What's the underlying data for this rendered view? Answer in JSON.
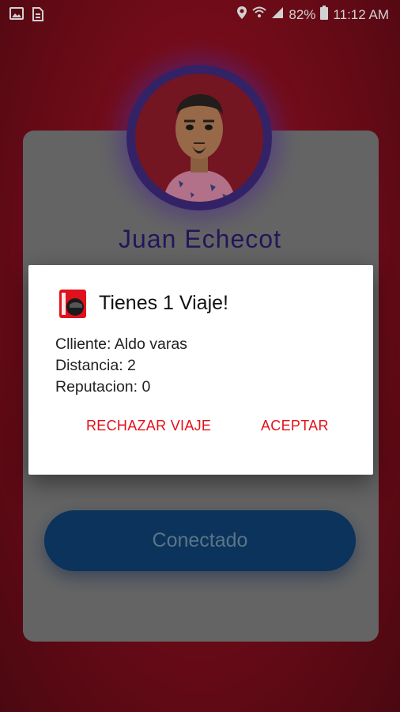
{
  "status_bar": {
    "battery": "82%",
    "time": "11:12 AM",
    "icons": [
      "image-icon",
      "document-icon",
      "location-icon",
      "wifi-icon",
      "signal-icon",
      "battery-icon"
    ]
  },
  "profile": {
    "name": "Juan Echecot",
    "avatar": "avatar-image"
  },
  "connect_button": {
    "label": "Conectado"
  },
  "dialog": {
    "icon": "helmet-app-icon",
    "title": "Tienes 1 Viaje!",
    "lines": [
      "Clliente: Aldo varas",
      "Distancia: 2",
      "Reputacion: 0"
    ],
    "reject_label": "RECHAZAR VIAJE",
    "accept_label": "ACEPTAR"
  },
  "colors": {
    "background": "#a5122a",
    "action_text": "#e3111a",
    "name_text": "#2d1a6e",
    "button": "#0e3f70"
  }
}
